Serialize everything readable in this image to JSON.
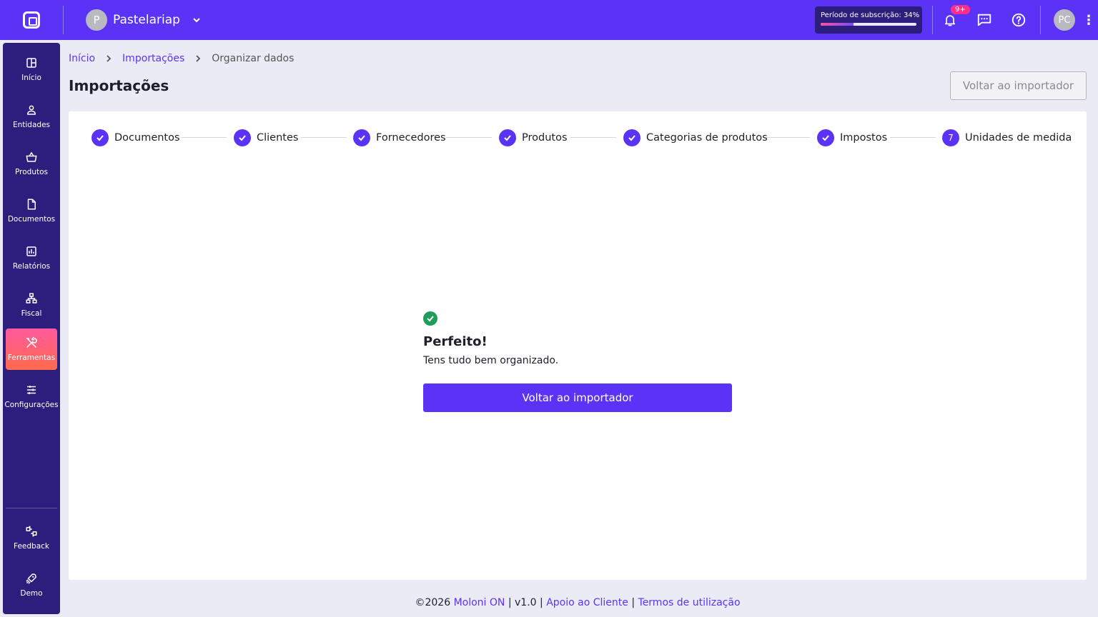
{
  "topbar": {
    "company_initial": "P",
    "company_name": "Pastelariap",
    "subscription_label": "Período de subscrição: 34%",
    "subscription_progress": 0.34,
    "notifications_badge": "9+",
    "user_initials": "PC"
  },
  "sidebar": {
    "items": [
      {
        "label": "Início",
        "icon": "dashboard-icon"
      },
      {
        "label": "Entidades",
        "icon": "user-icon"
      },
      {
        "label": "Produtos",
        "icon": "basket-icon"
      },
      {
        "label": "Documentos",
        "icon": "document-icon"
      },
      {
        "label": "Relatórios",
        "icon": "chart-icon"
      },
      {
        "label": "Fiscal",
        "icon": "network-icon"
      },
      {
        "label": "Ferramentas",
        "icon": "tools-icon",
        "active": true
      },
      {
        "label": "Configurações",
        "icon": "sliders-icon"
      }
    ],
    "bottom": [
      {
        "label": "Feedback",
        "icon": "feedback-icon"
      },
      {
        "label": "Demo",
        "icon": "rocket-icon"
      }
    ]
  },
  "breadcrumb": {
    "home": "Início",
    "imports": "Importações",
    "current": "Organizar dados"
  },
  "page": {
    "title": "Importações",
    "back_button": "Voltar ao importador"
  },
  "stepper": {
    "steps": [
      {
        "label": "Documentos",
        "state": "done"
      },
      {
        "label": "Clientes",
        "state": "done"
      },
      {
        "label": "Fornecedores",
        "state": "done"
      },
      {
        "label": "Produtos",
        "state": "done"
      },
      {
        "label": "Categorias de produtos",
        "state": "done"
      },
      {
        "label": "Impostos",
        "state": "done"
      },
      {
        "label": "Unidades de medida",
        "state": "current",
        "number": "7"
      }
    ]
  },
  "result": {
    "title": "Perfeito!",
    "text": "Tens tudo bem organizado.",
    "button": "Voltar ao importador"
  },
  "footer": {
    "copyright": "©2026",
    "brand": "Moloni ON",
    "version": "v1.0",
    "support": "Apoio ao Cliente",
    "terms": "Termos de utilização"
  },
  "colors": {
    "primary": "#5b33f6",
    "sidebar": "#2d1d7d",
    "success": "#1e9e5a",
    "badge": "#ff2e8a"
  }
}
